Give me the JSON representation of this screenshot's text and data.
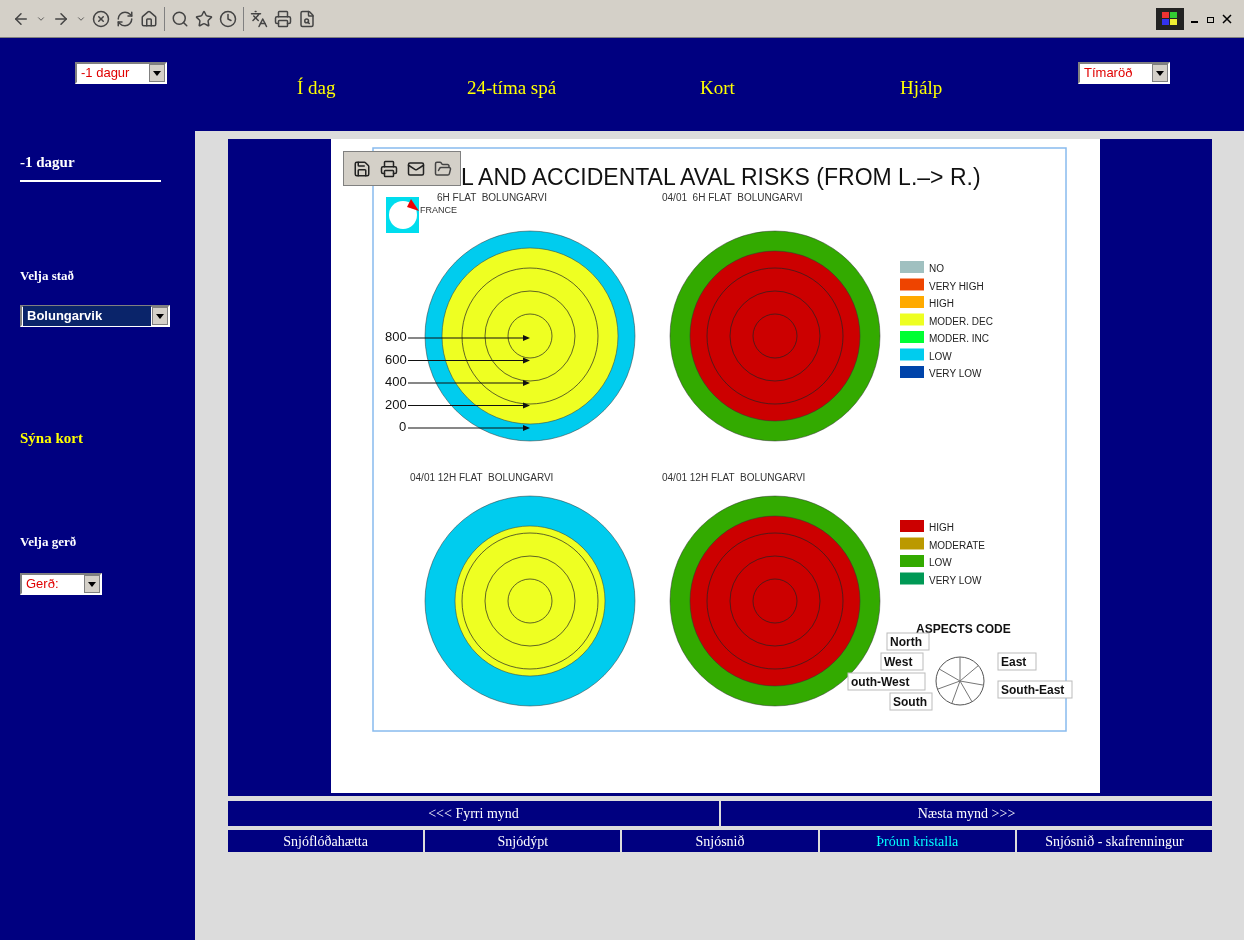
{
  "header": {
    "day_select": "-1 dagur",
    "nav": [
      {
        "label": "Í dag"
      },
      {
        "label": "24-tíma spá"
      },
      {
        "label": "Kort"
      },
      {
        "label": "Hjálp"
      }
    ],
    "series_select": "Tímaröð"
  },
  "sidebar": {
    "day_label": "-1 dagur",
    "place_label": "Velja stað",
    "place_select": "Bolungarvik",
    "show_map": "Sýna kort",
    "type_label": "Velja gerð",
    "type_select": "Gerð:"
  },
  "image": {
    "title": "L AND ACCIDENTAL AVAL RISKS (FROM L.–> R.)",
    "logo_text": "FRANCE",
    "panels": [
      {
        "caption": "6H FLAT  BOLUNGARVI",
        "rings": [
          {
            "color": "#00ccee"
          },
          {
            "color": "#eeff22"
          }
        ]
      },
      {
        "caption": "04/01  6H FLAT  BOLUNGARVI",
        "rings": [
          {
            "color": "#33aa00"
          },
          {
            "color": "#cc0000"
          }
        ]
      },
      {
        "caption": "04/01 12H FLAT  BOLUNGARVI",
        "rings": [
          {
            "color": "#00ccee"
          },
          {
            "color": "#eeff22"
          }
        ]
      },
      {
        "caption": "04/01 12H FLAT  BOLUNGARVI",
        "rings": [
          {
            "color": "#33aa00"
          },
          {
            "color": "#cc0000"
          }
        ]
      }
    ],
    "altitudes": [
      "800",
      "600",
      "400",
      "200",
      "0"
    ],
    "legend_top": [
      {
        "label": "NO",
        "color": "#a0c0c0"
      },
      {
        "label": "VERY HIGH",
        "color": "#ee4400"
      },
      {
        "label": "HIGH",
        "color": "#ffaa00"
      },
      {
        "label": "MODER. DEC",
        "color": "#eeff22"
      },
      {
        "label": "MODER. INC",
        "color": "#00ff33"
      },
      {
        "label": "LOW",
        "color": "#00ccee"
      },
      {
        "label": "VERY LOW",
        "color": "#0044aa"
      }
    ],
    "legend_bottom": [
      {
        "label": "HIGH",
        "color": "#cc0000"
      },
      {
        "label": "MODERATE",
        "color": "#bb9900"
      },
      {
        "label": "LOW",
        "color": "#33aa00"
      },
      {
        "label": "VERY LOW",
        "color": "#009955"
      }
    ],
    "aspects": {
      "title": "ASPECTS CODE",
      "labels": [
        "North",
        "West",
        "outh-West",
        "South",
        "East",
        "South-East"
      ]
    }
  },
  "pager": {
    "previous": "<<< Fyrri mynd",
    "next": "Næsta mynd >>>"
  },
  "tabs": [
    {
      "label": "Snjóflóðahætta",
      "selected": false
    },
    {
      "label": "Snjódýpt",
      "selected": false
    },
    {
      "label": "Snjósnið",
      "selected": false
    },
    {
      "label": "Þróun kristalla",
      "selected": true
    },
    {
      "label": "Snjósnið - skafrenningur",
      "selected": false
    }
  ]
}
